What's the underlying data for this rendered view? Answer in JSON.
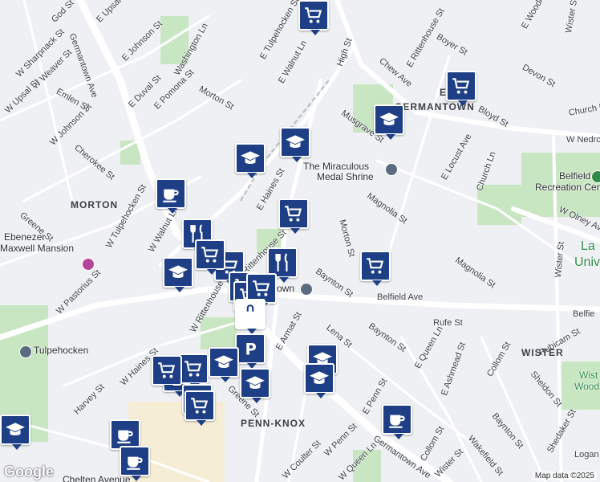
{
  "streets": [
    {
      "text": "Germantown Ave"
    },
    {
      "text": "Washington Ln"
    },
    {
      "text": "E Johnson St"
    },
    {
      "text": "W Johnson St"
    },
    {
      "text": "E Upsal St"
    },
    {
      "text": "God St"
    },
    {
      "text": "W Sharpnack St"
    },
    {
      "text": "W Weaver St"
    },
    {
      "text": "W Upsal St"
    },
    {
      "text": "E Duval St"
    },
    {
      "text": "E Pomona St"
    },
    {
      "text": "Morton St"
    },
    {
      "text": "Emlen St"
    },
    {
      "text": "Cherokee St"
    },
    {
      "text": "E Tulpehocken St"
    },
    {
      "text": "E Walnut Ln"
    },
    {
      "text": "High St"
    },
    {
      "text": "Chew Ave"
    },
    {
      "text": "E Rittenhouse St"
    },
    {
      "text": "Boyer St"
    },
    {
      "text": "E Woodlawn St"
    },
    {
      "text": "Devon St"
    },
    {
      "text": "Wister St"
    },
    {
      "text": "Church Ln"
    },
    {
      "text": "Bloyd St"
    },
    {
      "text": "W Nedro"
    },
    {
      "text": "Musgrave St"
    },
    {
      "text": "E Haines St"
    },
    {
      "text": "Magnolia St"
    },
    {
      "text": "Morton St"
    },
    {
      "text": "Baynton St"
    },
    {
      "text": "Belfield Ave"
    },
    {
      "text": "Rufe St"
    },
    {
      "text": "Lena St"
    },
    {
      "text": "E Armat St"
    },
    {
      "text": "E Queen Ln"
    },
    {
      "text": "E Ashmead St"
    },
    {
      "text": "Collom St"
    },
    {
      "text": "Rubicam St"
    },
    {
      "text": "Sheldon St"
    },
    {
      "text": "Baynton St"
    },
    {
      "text": "Wakefield St"
    },
    {
      "text": "Greene St"
    },
    {
      "text": "W Haines St"
    },
    {
      "text": "W Rittenhouse St"
    },
    {
      "text": "W Pastorius St"
    },
    {
      "text": "Harvey St"
    },
    {
      "text": "W Walnut Ln"
    },
    {
      "text": "W Tulpehocken St"
    },
    {
      "text": "W Coulter St"
    },
    {
      "text": "W Penn St"
    },
    {
      "text": "W Queen Ln"
    },
    {
      "text": "E Penn St"
    },
    {
      "text": "Germantown Ave"
    },
    {
      "text": "Wister St"
    },
    {
      "text": "Collom St"
    },
    {
      "text": "W Olney Ave"
    },
    {
      "text": "E Locust Ave"
    },
    {
      "text": "Church Ln"
    },
    {
      "text": "Magnolia St"
    },
    {
      "text": "Logan"
    },
    {
      "text": "Shedaker St"
    },
    {
      "text": "Belfie"
    },
    {
      "text": "Baynton St"
    },
    {
      "text": "Greene St"
    },
    {
      "text": "Wister St"
    },
    {
      "text": "Rittenhouse St"
    }
  ],
  "areas": [
    {
      "text": "MORTON"
    },
    {
      "text": "EAST"
    },
    {
      "text": "GERMANTOWN"
    },
    {
      "text": "WISTER"
    },
    {
      "text": "PENN-KNOX"
    }
  ],
  "pois": [
    {
      "text": "The Miraculous"
    },
    {
      "text": "Medal Shrine"
    },
    {
      "text": "Belfield"
    },
    {
      "text": "Recreation Center"
    },
    {
      "text": "Ebenezer"
    },
    {
      "text": "Maxwell Mansion"
    },
    {
      "text": "Tulpehocken"
    },
    {
      "text": "Chelten Avenue"
    },
    {
      "text": "own"
    },
    {
      "text": "La"
    },
    {
      "text": "Univ"
    },
    {
      "text": "Wist"
    },
    {
      "text": "Woods"
    }
  ],
  "markers": [
    {
      "type": "cart"
    },
    {
      "type": "cart"
    },
    {
      "type": "grad"
    },
    {
      "type": "grad"
    },
    {
      "type": "grad"
    },
    {
      "type": "grad"
    },
    {
      "type": "cart"
    },
    {
      "type": "coffee"
    },
    {
      "type": "cart"
    },
    {
      "type": "dining"
    },
    {
      "type": "grad"
    },
    {
      "type": "cart"
    },
    {
      "type": "cart"
    },
    {
      "type": "dining"
    },
    {
      "type": "cart"
    },
    {
      "type": "cart"
    },
    {
      "type": "cart"
    },
    {
      "type": "cart"
    },
    {
      "type": "bag"
    },
    {
      "type": "parking"
    },
    {
      "type": "cart"
    },
    {
      "type": "cart"
    },
    {
      "type": "grad"
    },
    {
      "type": "grad"
    },
    {
      "type": "grad"
    },
    {
      "type": "grad"
    },
    {
      "type": "cart"
    },
    {
      "type": "cart"
    },
    {
      "type": "coffee"
    },
    {
      "type": "coffee"
    },
    {
      "type": "coffee"
    },
    {
      "type": "grad"
    }
  ],
  "attribution": {
    "google": "Google",
    "map_data": "Map data ©2025"
  },
  "colors": {
    "marker": "#1e3f86",
    "park": "#c8e6c1",
    "road": "#ffffff",
    "land": "#eef0f3"
  }
}
